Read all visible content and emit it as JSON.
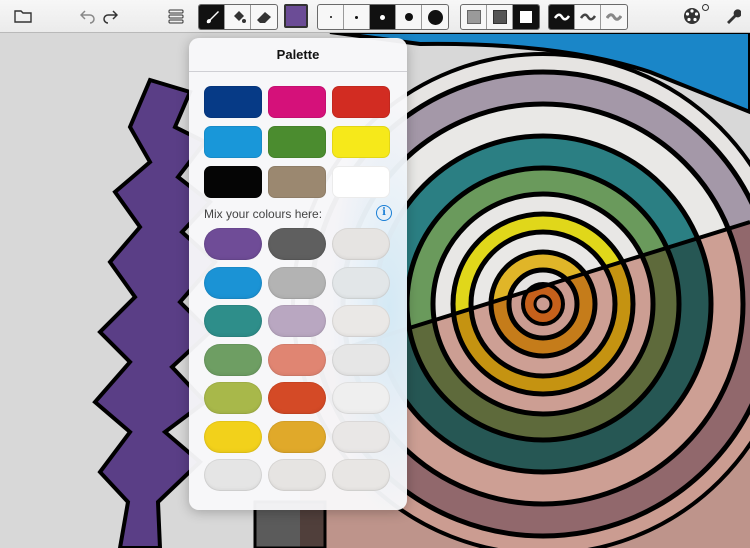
{
  "palette": {
    "title": "Palette",
    "mix_label": "Mix your colours here:",
    "info_icon": "i",
    "preset_colors": [
      "#063a86",
      "#d5117a",
      "#d22c22",
      "#1997d9",
      "#4b8c2f",
      "#f6e91a",
      "#050505",
      "#9b8870",
      "#ffffff"
    ],
    "mix_colors": [
      [
        "#6f4c97",
        "#5f5f5f",
        "#e6e4e2"
      ],
      [
        "#1b93d5",
        "#b3b3b3",
        "#e2e6e8"
      ],
      [
        "#2e8e8a",
        "#b9a7c1",
        "#eae8e6"
      ],
      [
        "#6e9e63",
        "#e08572",
        "#e6e6e6"
      ],
      [
        "#a8b84a",
        "#d44a26",
        "#efefef"
      ],
      [
        "#f2d11b",
        "#e0a92a",
        "#e9e7e6"
      ],
      [
        "#e5e5e5",
        "#e6e4e2",
        "#e8e6e4"
      ]
    ]
  },
  "toolbar": {
    "icons": [
      "folder-icon",
      "undo-icon",
      "redo-icon",
      "sliders-icon",
      "brush-icon",
      "fill-bucket-icon",
      "eraser-icon",
      "current-color-swatch",
      "brush-size-tiny",
      "brush-size-small",
      "brush-size-medium",
      "brush-size-large",
      "brush-size-xlarge",
      "texture-light-icon",
      "texture-medium-icon",
      "texture-solid-icon",
      "stroke-smooth-icon",
      "stroke-medium-icon",
      "stroke-soft-icon",
      "color-wheel-icon",
      "wrench-icon"
    ],
    "current_color": "#6b4c96"
  }
}
